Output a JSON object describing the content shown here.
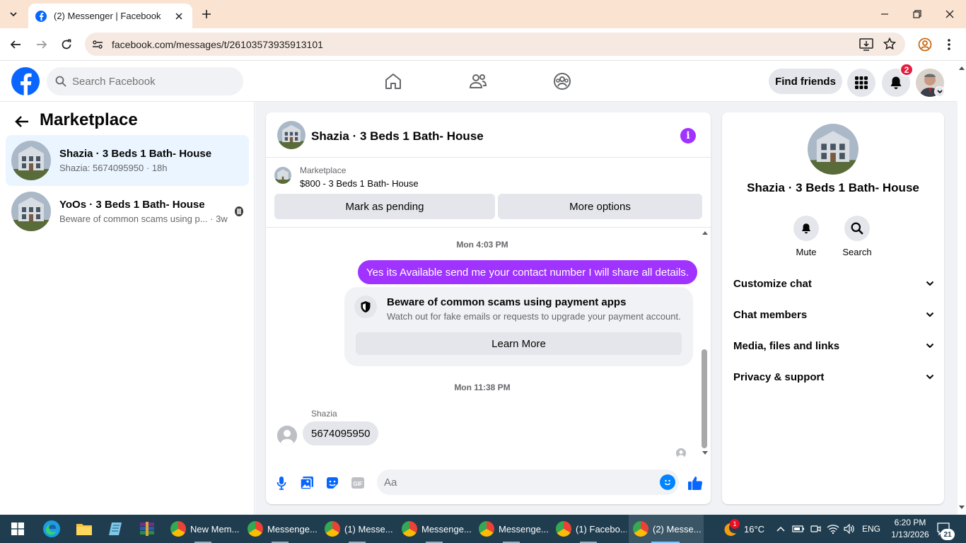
{
  "browser": {
    "tab_title": "(2) Messenger | Facebook",
    "url": "facebook.com/messages/t/26103573935913101"
  },
  "header": {
    "search_placeholder": "Search Facebook",
    "find_friends": "Find friends",
    "notification_count": "2"
  },
  "left_pane": {
    "title": "Marketplace",
    "threads": [
      {
        "name": "Shazia · 3 Beds 1 Bath- House",
        "preview": "Shazia: 5674095950 · 18h"
      },
      {
        "name": "YoOs · 3 Beds 1 Bath- House",
        "preview": "Beware of common scams using p... · 3w"
      }
    ]
  },
  "chat": {
    "title": "Shazia · 3 Beds 1 Bath- House",
    "marketplace_label": "Marketplace",
    "listing": "$800 - 3 Beds 1 Bath- House",
    "mark_pending": "Mark as pending",
    "more_options": "More options",
    "timestamp1": "Mon 4:03 PM",
    "outgoing_message": "Yes its Available send me your contact number I will share all details.",
    "scam_title": "Beware of common scams using payment apps",
    "scam_body": "Watch out for fake emails or requests to upgrade your payment account.",
    "learn_more": "Learn More",
    "timestamp2": "Mon 11:38 PM",
    "sender": "Shazia",
    "incoming_message": "5674095950",
    "input_placeholder": "Aa"
  },
  "info_panel": {
    "name": "Shazia · 3 Beds 1 Bath- House",
    "mute": "Mute",
    "search": "Search",
    "sections": [
      "Customize chat",
      "Chat members",
      "Media, files and links",
      "Privacy & support"
    ]
  },
  "taskbar": {
    "tasks": [
      "New Mem...",
      "Messenge...",
      "(1) Messe...",
      "Messenge...",
      "Messenge...",
      "(1) Facebo...",
      "(2) Messe..."
    ],
    "weather": "16°C",
    "weather_badge": "1",
    "language": "ENG",
    "time": "6:20 PM",
    "date": "1/13/2026",
    "notification_count": "21"
  },
  "colors": {
    "facebook_blue": "#0866ff",
    "messenger_purple": "#a033ff",
    "taskbar": "#1f3d4f"
  }
}
